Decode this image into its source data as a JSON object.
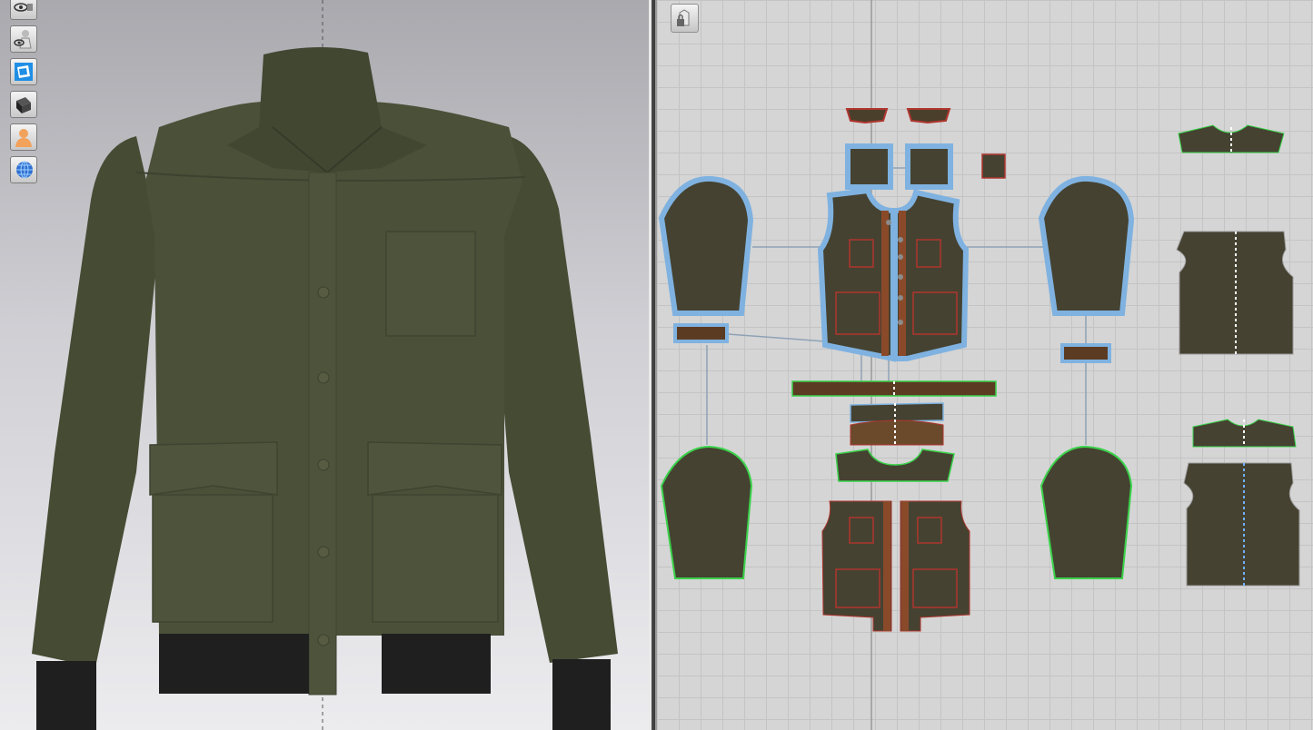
{
  "viewport_3d": {
    "toolbar": [
      {
        "icon": "eye-garment-icon"
      },
      {
        "icon": "eye-avatar-icon"
      },
      {
        "icon": "fabric-display-icon"
      },
      {
        "icon": "texture-display-icon"
      },
      {
        "icon": "avatar-display-icon"
      },
      {
        "icon": "globe-eye-icon"
      }
    ],
    "garment": {
      "fabric_color": "#4b5039",
      "rib_color": "#1e1f1e"
    }
  },
  "viewport_2d": {
    "toolbar_icon": "lock-pattern-icon",
    "colors": {
      "pattern_fill": "#454231",
      "selected_outline": "#7fb2e0",
      "sewing_line": "#3ad24a",
      "binding": "#5b3c22",
      "internal_line": "#b0352e"
    }
  }
}
